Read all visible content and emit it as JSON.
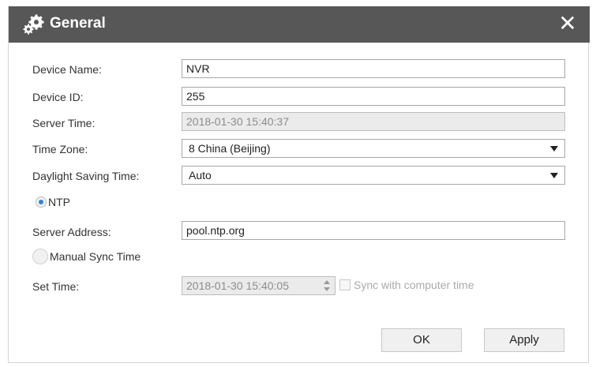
{
  "dialog": {
    "title": "General",
    "title_icon": "gears-icon",
    "close_icon": "close-icon",
    "close_glyph": "✕"
  },
  "form": {
    "device_name": {
      "label": "Device Name:",
      "value": "NVR"
    },
    "device_id": {
      "label": "Device ID:",
      "value": "255"
    },
    "server_time": {
      "label": "Server Time:",
      "value": "2018-01-30 15:40:37"
    },
    "time_zone": {
      "label": "Time Zone:",
      "value": "8 China (Beijing)"
    },
    "daylight_saving": {
      "label": "Daylight Saving Time:",
      "value": "Auto"
    },
    "ntp": {
      "label": "NTP",
      "selected": true
    },
    "server_address": {
      "label": "Server Address:",
      "value": "pool.ntp.org"
    },
    "manual_sync": {
      "label": "Manual Sync Time",
      "selected": false
    },
    "set_time": {
      "label": "Set Time:",
      "value": "2018-01-30 15:40:05"
    },
    "sync_computer": {
      "label": "Sync with computer time",
      "checked": false
    }
  },
  "buttons": {
    "ok": "OK",
    "apply": "Apply"
  },
  "colors": {
    "titlebar": "#575757",
    "radio_accent": "#2e86de",
    "disabled_bg": "#ebebeb"
  }
}
